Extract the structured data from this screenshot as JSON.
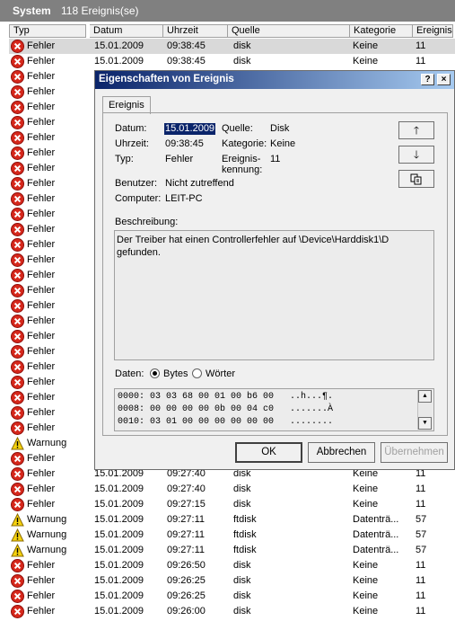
{
  "header": {
    "title": "System",
    "count": "118 Ereignis(se)"
  },
  "columns": [
    "Typ",
    "Datum",
    "Uhrzeit",
    "Quelle",
    "Kategorie",
    "Ereignis"
  ],
  "rows": [
    {
      "type": "Fehler",
      "icon": "error",
      "date": "15.01.2009",
      "time": "09:38:45",
      "source": "disk",
      "category": "Keine",
      "event": "11"
    },
    {
      "type": "Fehler",
      "icon": "error",
      "date": "15.01.2009",
      "time": "09:38:45",
      "source": "disk",
      "category": "Keine",
      "event": "11"
    },
    {
      "type": "Fehler",
      "icon": "error",
      "date": "",
      "time": "",
      "source": "",
      "category": "",
      "event": ""
    },
    {
      "type": "Fehler",
      "icon": "error",
      "date": "",
      "time": "",
      "source": "",
      "category": "",
      "event": ""
    },
    {
      "type": "Fehler",
      "icon": "error",
      "date": "",
      "time": "",
      "source": "",
      "category": "",
      "event": ""
    },
    {
      "type": "Fehler",
      "icon": "error",
      "date": "",
      "time": "",
      "source": "",
      "category": "",
      "event": ""
    },
    {
      "type": "Fehler",
      "icon": "error",
      "date": "",
      "time": "",
      "source": "",
      "category": "",
      "event": ""
    },
    {
      "type": "Fehler",
      "icon": "error",
      "date": "",
      "time": "",
      "source": "",
      "category": "",
      "event": ""
    },
    {
      "type": "Fehler",
      "icon": "error",
      "date": "",
      "time": "",
      "source": "",
      "category": "",
      "event": ""
    },
    {
      "type": "Fehler",
      "icon": "error",
      "date": "",
      "time": "",
      "source": "",
      "category": "",
      "event": ""
    },
    {
      "type": "Fehler",
      "icon": "error",
      "date": "",
      "time": "",
      "source": "",
      "category": "",
      "event": ""
    },
    {
      "type": "Fehler",
      "icon": "error",
      "date": "",
      "time": "",
      "source": "",
      "category": "",
      "event": ""
    },
    {
      "type": "Fehler",
      "icon": "error",
      "date": "",
      "time": "",
      "source": "",
      "category": "",
      "event": ""
    },
    {
      "type": "Fehler",
      "icon": "error",
      "date": "",
      "time": "",
      "source": "",
      "category": "",
      "event": ""
    },
    {
      "type": "Fehler",
      "icon": "error",
      "date": "",
      "time": "",
      "source": "",
      "category": "",
      "event": ""
    },
    {
      "type": "Fehler",
      "icon": "error",
      "date": "",
      "time": "",
      "source": "",
      "category": "",
      "event": ""
    },
    {
      "type": "Fehler",
      "icon": "error",
      "date": "",
      "time": "",
      "source": "",
      "category": "",
      "event": ""
    },
    {
      "type": "Fehler",
      "icon": "error",
      "date": "",
      "time": "",
      "source": "",
      "category": "",
      "event": ""
    },
    {
      "type": "Fehler",
      "icon": "error",
      "date": "",
      "time": "",
      "source": "",
      "category": "",
      "event": ""
    },
    {
      "type": "Fehler",
      "icon": "error",
      "date": "",
      "time": "",
      "source": "",
      "category": "",
      "event": ""
    },
    {
      "type": "Fehler",
      "icon": "error",
      "date": "",
      "time": "",
      "source": "",
      "category": "",
      "event": ""
    },
    {
      "type": "Fehler",
      "icon": "error",
      "date": "",
      "time": "",
      "source": "",
      "category": "",
      "event": ""
    },
    {
      "type": "Fehler",
      "icon": "error",
      "date": "",
      "time": "",
      "source": "",
      "category": "",
      "event": ""
    },
    {
      "type": "Fehler",
      "icon": "error",
      "date": "",
      "time": "",
      "source": "",
      "category": "",
      "event": ""
    },
    {
      "type": "Fehler",
      "icon": "error",
      "date": "",
      "time": "",
      "source": "",
      "category": "",
      "event": ""
    },
    {
      "type": "Fehler",
      "icon": "error",
      "date": "",
      "time": "",
      "source": "",
      "category": "",
      "event": ""
    },
    {
      "type": "Warnung",
      "icon": "warning",
      "date": "",
      "time": "",
      "source": "",
      "category": "",
      "event": ""
    },
    {
      "type": "Fehler",
      "icon": "error",
      "date": "",
      "time": "",
      "source": "",
      "category": "",
      "event": ""
    },
    {
      "type": "Fehler",
      "icon": "error",
      "date": "15.01.2009",
      "time": "09:27:40",
      "source": "disk",
      "category": "Keine",
      "event": "11"
    },
    {
      "type": "Fehler",
      "icon": "error",
      "date": "15.01.2009",
      "time": "09:27:40",
      "source": "disk",
      "category": "Keine",
      "event": "11"
    },
    {
      "type": "Fehler",
      "icon": "error",
      "date": "15.01.2009",
      "time": "09:27:15",
      "source": "disk",
      "category": "Keine",
      "event": "11"
    },
    {
      "type": "Warnung",
      "icon": "warning",
      "date": "15.01.2009",
      "time": "09:27:11",
      "source": "ftdisk",
      "category": "Datenträ...",
      "event": "57"
    },
    {
      "type": "Warnung",
      "icon": "warning",
      "date": "15.01.2009",
      "time": "09:27:11",
      "source": "ftdisk",
      "category": "Datenträ...",
      "event": "57"
    },
    {
      "type": "Warnung",
      "icon": "warning",
      "date": "15.01.2009",
      "time": "09:27:11",
      "source": "ftdisk",
      "category": "Datenträ...",
      "event": "57"
    },
    {
      "type": "Fehler",
      "icon": "error",
      "date": "15.01.2009",
      "time": "09:26:50",
      "source": "disk",
      "category": "Keine",
      "event": "11"
    },
    {
      "type": "Fehler",
      "icon": "error",
      "date": "15.01.2009",
      "time": "09:26:25",
      "source": "disk",
      "category": "Keine",
      "event": "11"
    },
    {
      "type": "Fehler",
      "icon": "error",
      "date": "15.01.2009",
      "time": "09:26:25",
      "source": "disk",
      "category": "Keine",
      "event": "11"
    },
    {
      "type": "Fehler",
      "icon": "error",
      "date": "15.01.2009",
      "time": "09:26:00",
      "source": "disk",
      "category": "Keine",
      "event": "11"
    }
  ],
  "dialog": {
    "title": "Eigenschaften von Ereignis",
    "help_label": "?",
    "close_label": "×",
    "tab": "Ereignis",
    "datum_label": "Datum:",
    "datum_value": "15.01.2009",
    "quelle_label": "Quelle:",
    "quelle_value": "Disk",
    "uhrzeit_label": "Uhrzeit:",
    "uhrzeit_value": "09:38:45",
    "kategorie_label": "Kategorie:",
    "kategorie_value": "Keine",
    "typ_label": "Typ:",
    "typ_value": "Fehler",
    "kennung_label_1": "Ereignis-",
    "kennung_label_2": "kennung:",
    "kennung_value": "11",
    "benutzer_label": "Benutzer:",
    "benutzer_value": "Nicht zutreffend",
    "computer_label": "Computer:",
    "computer_value": "LEIT-PC",
    "beschreibung_label": "Beschreibung:",
    "beschreibung_text": "Der Treiber hat einen Controllerfehler auf \\Device\\Harddisk1\\D gefunden.",
    "daten_label": "Daten:",
    "bytes_label": "Bytes",
    "woerter_label": "Wörter",
    "data_format_selected": "Bytes",
    "hex_lines": [
      "0000: 03 03 68 00 01 00 b6 00   ..h...¶.",
      "0008: 00 00 00 00 0b 00 04 c0   .......À",
      "0010: 03 01 00 00 00 00 00 00   ........"
    ],
    "ok_label": "OK",
    "cancel_label": "Abbrechen",
    "apply_label": "Übernehmen"
  }
}
